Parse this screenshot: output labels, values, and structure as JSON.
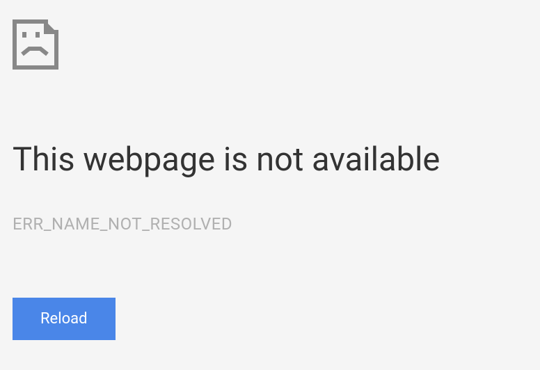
{
  "error": {
    "title": "This webpage is not available",
    "code": "ERR_NAME_NOT_RESOLVED"
  },
  "actions": {
    "reload_label": "Reload"
  },
  "colors": {
    "background": "#f5f5f5",
    "text_primary": "#333333",
    "text_secondary": "#b0b0b0",
    "button_bg": "#4a86e8",
    "button_text": "#ffffff"
  },
  "icon": {
    "name": "sad-document"
  }
}
